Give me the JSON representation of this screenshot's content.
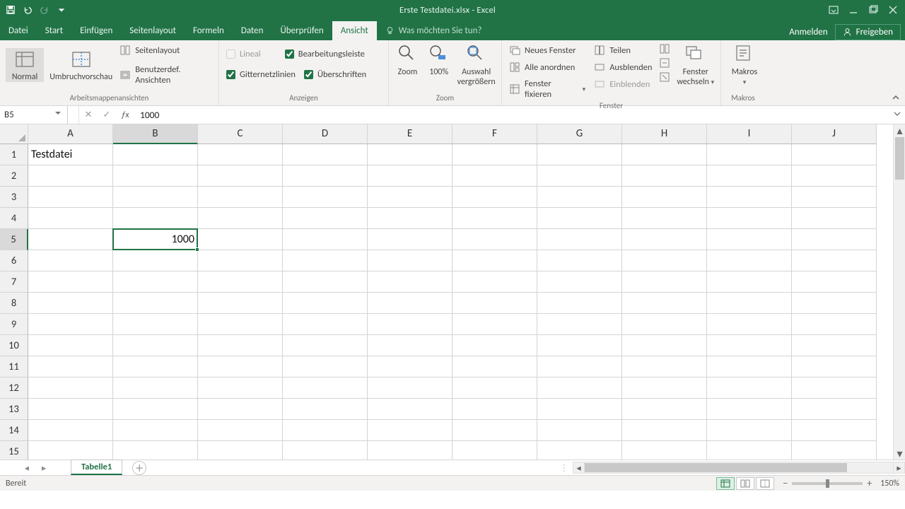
{
  "titlebar": {
    "title": "Erste Testdatei.xlsx - Excel"
  },
  "tabs": {
    "file": "Datei",
    "items": [
      "Start",
      "Einfügen",
      "Seitenlayout",
      "Formeln",
      "Daten",
      "Überprüfen",
      "Ansicht"
    ],
    "active": "Ansicht",
    "tell_me": "Was möchten Sie tun?",
    "signin": "Anmelden",
    "share": "Freigeben"
  },
  "ribbon": {
    "groups": {
      "views": {
        "label": "Arbeitsmappenansichten",
        "normal": "Normal",
        "pagebreak": "Umbruchvorschau",
        "pagelayout": "Seitenlayout",
        "custom": "Benutzerdef. Ansichten"
      },
      "show": {
        "label": "Anzeigen",
        "ruler": "Lineal",
        "formula_bar": "Bearbeitungsleiste",
        "gridlines": "Gitternetzlinien",
        "headings": "Überschriften"
      },
      "zoom": {
        "label": "Zoom",
        "zoom": "Zoom",
        "p100": "100%",
        "selection_l1": "Auswahl",
        "selection_l2": "vergrößern"
      },
      "window": {
        "label": "Fenster",
        "new": "Neues Fenster",
        "arrange": "Alle anordnen",
        "freeze": "Fenster fixieren",
        "split": "Teilen",
        "hide": "Ausblenden",
        "unhide": "Einblenden",
        "switch_l1": "Fenster",
        "switch_l2": "wechseln"
      },
      "macros": {
        "label": "Makros",
        "btn": "Makros"
      }
    }
  },
  "formula_bar": {
    "name_box": "B5",
    "formula": "1000"
  },
  "grid": {
    "columns": [
      "A",
      "B",
      "C",
      "D",
      "E",
      "F",
      "G",
      "H",
      "I",
      "J"
    ],
    "row_count": 15,
    "active_col": "B",
    "active_row": 5,
    "cells": {
      "A1": {
        "v": "Testdatei",
        "align": "left"
      },
      "B5": {
        "v": "1000",
        "align": "right"
      }
    }
  },
  "sheets": {
    "tabs": [
      "Tabelle1"
    ],
    "active": "Tabelle1"
  },
  "status": {
    "msg": "Bereit",
    "zoom": "150%"
  }
}
